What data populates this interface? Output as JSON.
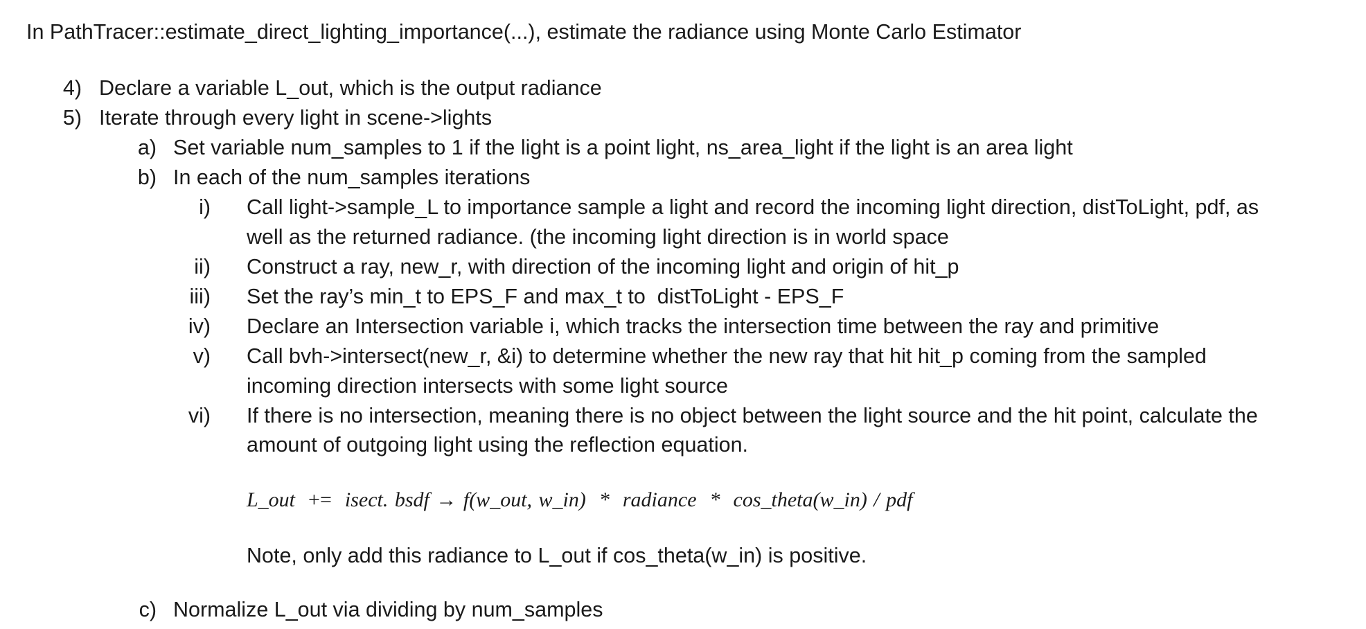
{
  "intro": "In PathTracer::estimate_direct_lighting_importance(...), estimate the radiance using Monte Carlo Estimator",
  "steps": [
    {
      "marker": "4)",
      "text": "Declare a variable L_out, which is the output radiance"
    },
    {
      "marker": "5)",
      "text": "Iterate through every light in scene->lights"
    }
  ],
  "substeps": [
    {
      "marker": "a)",
      "text": "Set variable num_samples to 1 if the light is a point light, ns_area_light if the light is an area light"
    },
    {
      "marker": "b)",
      "text": "In each of the num_samples iterations"
    },
    {
      "marker": "c)",
      "text": "Normalize L_out via dividing by num_samples"
    }
  ],
  "items": [
    {
      "marker": "i)",
      "lines": [
        "Call light->sample_L to importance sample a light and record the incoming light direction, distToLight, pdf, as",
        "well as the returned radiance. (the incoming light direction is in world space"
      ]
    },
    {
      "marker": "ii)",
      "lines": [
        "Construct a ray, new_r, with direction of the incoming light and origin of hit_p"
      ]
    },
    {
      "marker": "iii)",
      "lines": [
        "Set the ray’s min_t to EPS_F and max_t to  distToLight - EPS_F"
      ]
    },
    {
      "marker": "iv)",
      "lines": [
        "Declare an Intersection variable i, which tracks the intersection time between the ray and primitive"
      ]
    },
    {
      "marker": "v)",
      "lines": [
        "Call bvh->intersect(new_r, &i) to determine whether the new ray that hit hit_p coming from the sampled",
        "incoming direction intersects with some light source"
      ]
    },
    {
      "marker": "vi)",
      "lines": [
        "If there is no intersection, meaning there is no object between the light source and the hit point, calculate the",
        "amount of outgoing light using the reflection equation."
      ]
    }
  ],
  "equation": {
    "lhs": "L_out",
    "op": "+=",
    "rhs": "isect. bsdf → f(w_out, w_in)  *  radiance  *  cos_theta(w_in) / pdf"
  },
  "note": "Note, only add this radiance to L_out if cos_theta(w_in) is positive."
}
